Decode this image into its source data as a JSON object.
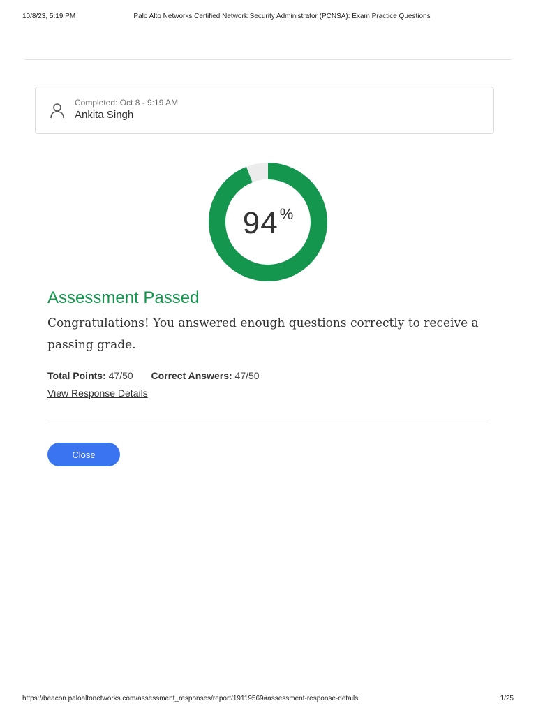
{
  "print_header": {
    "date": "10/8/23, 5:19 PM",
    "title": "Palo Alto Networks Certified Network Security Administrator (PCNSA): Exam Practice Questions"
  },
  "user_card": {
    "icon": "user-icon",
    "completed": "Completed: Oct 8 - 9:19 AM",
    "name": "Ankita Singh"
  },
  "score": {
    "value": "94",
    "unit": "%",
    "fraction": 0.94,
    "colors": {
      "fill": "#14964f",
      "track": "#ececec"
    }
  },
  "result": {
    "title": "Assessment Passed",
    "message": "Congratulations! You answered enough questions correctly to receive a passing grade.",
    "total_points_label": "Total Points:",
    "total_points_value": "47/50",
    "correct_answers_label": "Correct Answers:",
    "correct_answers_value": "47/50",
    "details_link": "View Response Details"
  },
  "actions": {
    "close_label": "Close",
    "close_color": "#3b74f0"
  },
  "print_footer": {
    "url": "https://beacon.paloaltonetworks.com/assessment_responses/report/19119569#assessment-response-details",
    "page": "1/25"
  }
}
